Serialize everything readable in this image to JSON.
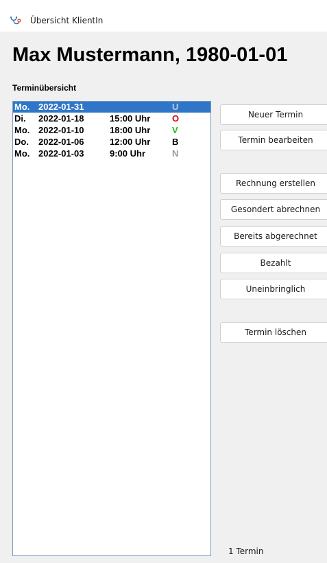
{
  "window": {
    "title": "Übersicht KlientIn",
    "icon": "stethoscope-icon"
  },
  "client": {
    "heading": "Max Mustermann, 1980-01-01"
  },
  "appointments": {
    "label": "Terminübersicht",
    "rows": [
      {
        "day": "Mo.",
        "date": "2022-01-31",
        "time": "",
        "status": "U",
        "status_color": "#c8c8c8",
        "selected": true
      },
      {
        "day": "Di.",
        "date": "2022-01-18",
        "time": "15:00 Uhr",
        "status": "O",
        "status_color": "#e0000f",
        "selected": false
      },
      {
        "day": "Mo.",
        "date": "2022-01-10",
        "time": "18:00 Uhr",
        "status": "V",
        "status_color": "#1fbf1f",
        "selected": false
      },
      {
        "day": "Do.",
        "date": "2022-01-06",
        "time": "12:00 Uhr",
        "status": "B",
        "status_color": "#000000",
        "selected": false
      },
      {
        "day": "Mo.",
        "date": "2022-01-03",
        "time": "9:00 Uhr",
        "status": "N",
        "status_color": "#9a9a9a",
        "selected": false
      }
    ],
    "count_text": "1 Termin"
  },
  "actions": {
    "new_appointment": "Neuer Termin",
    "edit_appointment": "Termin bearbeiten",
    "create_invoice": "Rechnung erstellen",
    "bill_separately": "Gesondert abrechnen",
    "already_billed": "Bereits abgerechnet",
    "paid": "Bezahlt",
    "uncollectible": "Uneinbringlich",
    "delete_appointment": "Termin löschen"
  },
  "colors": {
    "selection": "#2f76c8",
    "list_border": "#7a9cc5"
  }
}
